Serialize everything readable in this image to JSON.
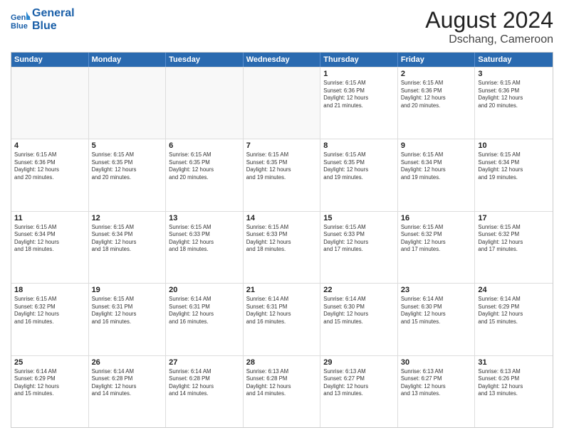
{
  "header": {
    "logo_line1": "General",
    "logo_line2": "Blue",
    "title": "August 2024",
    "subtitle": "Dschang, Cameroon"
  },
  "weekdays": [
    "Sunday",
    "Monday",
    "Tuesday",
    "Wednesday",
    "Thursday",
    "Friday",
    "Saturday"
  ],
  "rows": [
    [
      {
        "day": "",
        "empty": true
      },
      {
        "day": "",
        "empty": true
      },
      {
        "day": "",
        "empty": true
      },
      {
        "day": "",
        "empty": true
      },
      {
        "day": "1",
        "info": "Sunrise: 6:15 AM\nSunset: 6:36 PM\nDaylight: 12 hours\nand 21 minutes."
      },
      {
        "day": "2",
        "info": "Sunrise: 6:15 AM\nSunset: 6:36 PM\nDaylight: 12 hours\nand 20 minutes."
      },
      {
        "day": "3",
        "info": "Sunrise: 6:15 AM\nSunset: 6:36 PM\nDaylight: 12 hours\nand 20 minutes."
      }
    ],
    [
      {
        "day": "4",
        "info": "Sunrise: 6:15 AM\nSunset: 6:36 PM\nDaylight: 12 hours\nand 20 minutes."
      },
      {
        "day": "5",
        "info": "Sunrise: 6:15 AM\nSunset: 6:35 PM\nDaylight: 12 hours\nand 20 minutes."
      },
      {
        "day": "6",
        "info": "Sunrise: 6:15 AM\nSunset: 6:35 PM\nDaylight: 12 hours\nand 20 minutes."
      },
      {
        "day": "7",
        "info": "Sunrise: 6:15 AM\nSunset: 6:35 PM\nDaylight: 12 hours\nand 19 minutes."
      },
      {
        "day": "8",
        "info": "Sunrise: 6:15 AM\nSunset: 6:35 PM\nDaylight: 12 hours\nand 19 minutes."
      },
      {
        "day": "9",
        "info": "Sunrise: 6:15 AM\nSunset: 6:34 PM\nDaylight: 12 hours\nand 19 minutes."
      },
      {
        "day": "10",
        "info": "Sunrise: 6:15 AM\nSunset: 6:34 PM\nDaylight: 12 hours\nand 19 minutes."
      }
    ],
    [
      {
        "day": "11",
        "info": "Sunrise: 6:15 AM\nSunset: 6:34 PM\nDaylight: 12 hours\nand 18 minutes."
      },
      {
        "day": "12",
        "info": "Sunrise: 6:15 AM\nSunset: 6:34 PM\nDaylight: 12 hours\nand 18 minutes."
      },
      {
        "day": "13",
        "info": "Sunrise: 6:15 AM\nSunset: 6:33 PM\nDaylight: 12 hours\nand 18 minutes."
      },
      {
        "day": "14",
        "info": "Sunrise: 6:15 AM\nSunset: 6:33 PM\nDaylight: 12 hours\nand 18 minutes."
      },
      {
        "day": "15",
        "info": "Sunrise: 6:15 AM\nSunset: 6:33 PM\nDaylight: 12 hours\nand 17 minutes."
      },
      {
        "day": "16",
        "info": "Sunrise: 6:15 AM\nSunset: 6:32 PM\nDaylight: 12 hours\nand 17 minutes."
      },
      {
        "day": "17",
        "info": "Sunrise: 6:15 AM\nSunset: 6:32 PM\nDaylight: 12 hours\nand 17 minutes."
      }
    ],
    [
      {
        "day": "18",
        "info": "Sunrise: 6:15 AM\nSunset: 6:32 PM\nDaylight: 12 hours\nand 16 minutes."
      },
      {
        "day": "19",
        "info": "Sunrise: 6:15 AM\nSunset: 6:31 PM\nDaylight: 12 hours\nand 16 minutes."
      },
      {
        "day": "20",
        "info": "Sunrise: 6:14 AM\nSunset: 6:31 PM\nDaylight: 12 hours\nand 16 minutes."
      },
      {
        "day": "21",
        "info": "Sunrise: 6:14 AM\nSunset: 6:31 PM\nDaylight: 12 hours\nand 16 minutes."
      },
      {
        "day": "22",
        "info": "Sunrise: 6:14 AM\nSunset: 6:30 PM\nDaylight: 12 hours\nand 15 minutes."
      },
      {
        "day": "23",
        "info": "Sunrise: 6:14 AM\nSunset: 6:30 PM\nDaylight: 12 hours\nand 15 minutes."
      },
      {
        "day": "24",
        "info": "Sunrise: 6:14 AM\nSunset: 6:29 PM\nDaylight: 12 hours\nand 15 minutes."
      }
    ],
    [
      {
        "day": "25",
        "info": "Sunrise: 6:14 AM\nSunset: 6:29 PM\nDaylight: 12 hours\nand 15 minutes."
      },
      {
        "day": "26",
        "info": "Sunrise: 6:14 AM\nSunset: 6:28 PM\nDaylight: 12 hours\nand 14 minutes."
      },
      {
        "day": "27",
        "info": "Sunrise: 6:14 AM\nSunset: 6:28 PM\nDaylight: 12 hours\nand 14 minutes."
      },
      {
        "day": "28",
        "info": "Sunrise: 6:13 AM\nSunset: 6:28 PM\nDaylight: 12 hours\nand 14 minutes."
      },
      {
        "day": "29",
        "info": "Sunrise: 6:13 AM\nSunset: 6:27 PM\nDaylight: 12 hours\nand 13 minutes."
      },
      {
        "day": "30",
        "info": "Sunrise: 6:13 AM\nSunset: 6:27 PM\nDaylight: 12 hours\nand 13 minutes."
      },
      {
        "day": "31",
        "info": "Sunrise: 6:13 AM\nSunset: 6:26 PM\nDaylight: 12 hours\nand 13 minutes."
      }
    ]
  ]
}
